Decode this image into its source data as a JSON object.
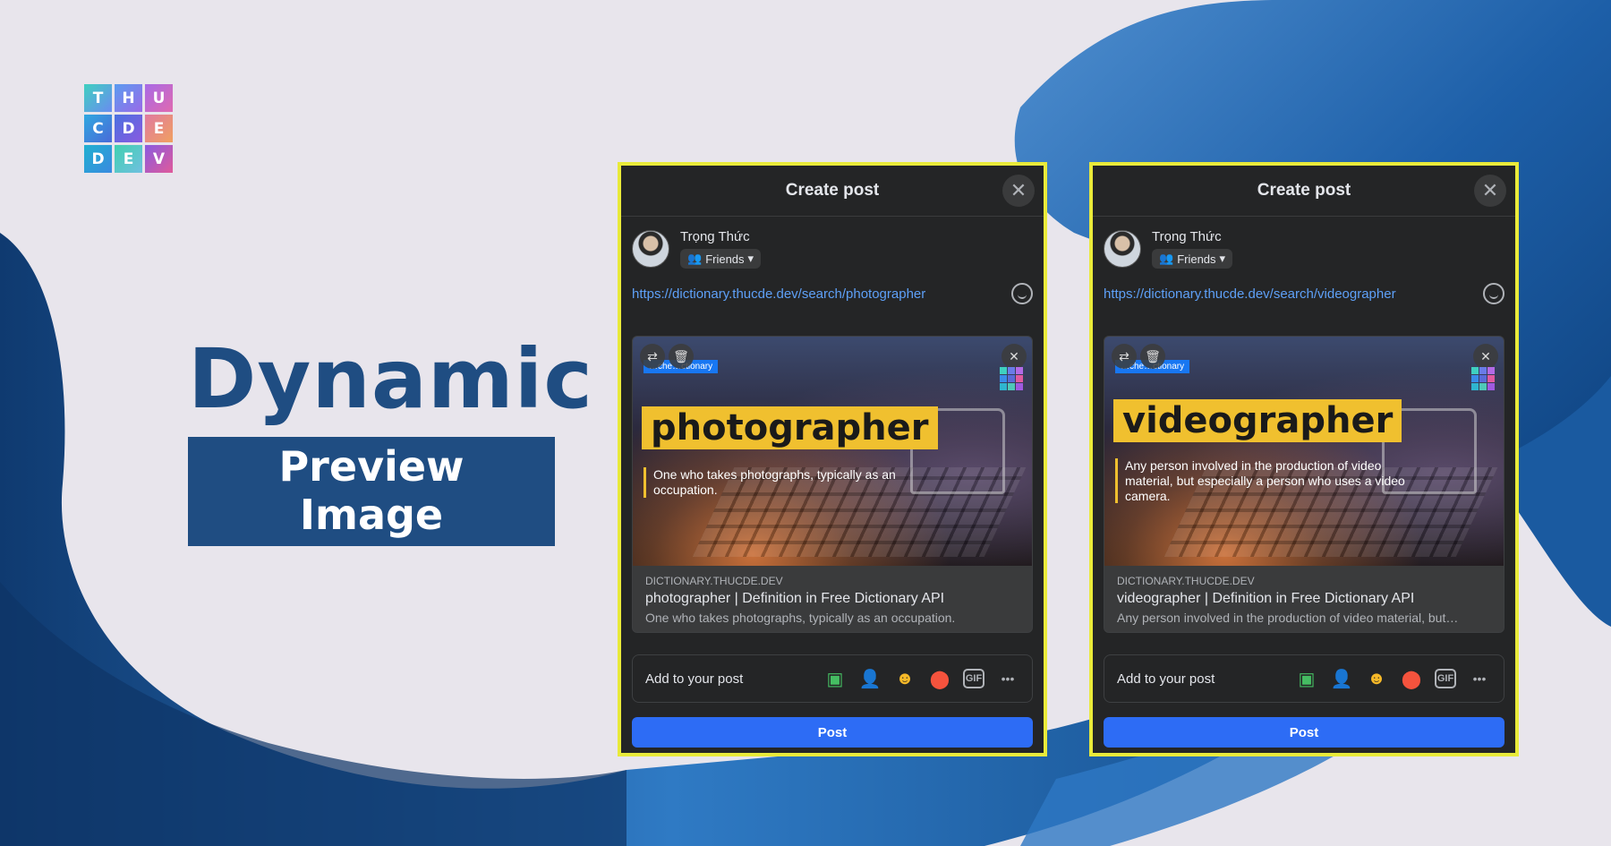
{
  "logo": {
    "letters": [
      "T",
      "H",
      "U",
      "C",
      "D",
      "E",
      "D",
      "E",
      "V"
    ],
    "colors": [
      "#3fbfe0",
      "#6a7be8",
      "#b36ae6",
      "#3a8be8",
      "#5a6ad8",
      "#e05aa0",
      "#2fb5d0",
      "#4fc8b8",
      "#a05ae0"
    ]
  },
  "headline": {
    "line1": "Dynamic",
    "line2": "Preview Image"
  },
  "dialogs": [
    {
      "title": "Create post",
      "user": "Trọng Thức",
      "audience": "Friends",
      "url": "https://dictionary.thucde.dev/search/photographer",
      "preview_tag": "…che…ctionary",
      "word": "photographer",
      "definition": "One who takes photographs, typically as an occupation.",
      "site": "DICTIONARY.THUCDE.DEV",
      "link_title": "photographer | Definition in Free Dictionary API",
      "link_desc": "One who takes photographs, typically as an occupation.",
      "add_label": "Add to your post",
      "post_label": "Post"
    },
    {
      "title": "Create post",
      "user": "Trọng Thức",
      "audience": "Friends",
      "url": "https://dictionary.thucde.dev/search/videographer",
      "preview_tag": "…che…ctionary",
      "word": "videographer",
      "definition": "Any person involved in the production of video material, but especially a person who uses a video camera.",
      "site": "DICTIONARY.THUCDE.DEV",
      "link_title": "videographer | Definition in Free Dictionary API",
      "link_desc": "Any person involved in the production of video material, but…",
      "add_label": "Add to your post",
      "post_label": "Post"
    }
  ],
  "add_icons": [
    {
      "name": "photo-icon",
      "glyph": "▣",
      "color": "#45bd62"
    },
    {
      "name": "tag-people-icon",
      "glyph": "👤",
      "color": "#1877f2"
    },
    {
      "name": "feeling-icon",
      "glyph": "☻",
      "color": "#f7b928"
    },
    {
      "name": "location-icon",
      "glyph": "●",
      "color": "#f5533d"
    },
    {
      "name": "gif-icon",
      "glyph": "GIF",
      "color": "#b0b3b8"
    },
    {
      "name": "more-icon",
      "glyph": "•••",
      "color": "#b0b3b8"
    }
  ],
  "colors": {
    "frame": "#e9ea3a",
    "accent": "#2d6cf5",
    "brand": "#1f4d82",
    "word_bg": "#f0c02f"
  }
}
